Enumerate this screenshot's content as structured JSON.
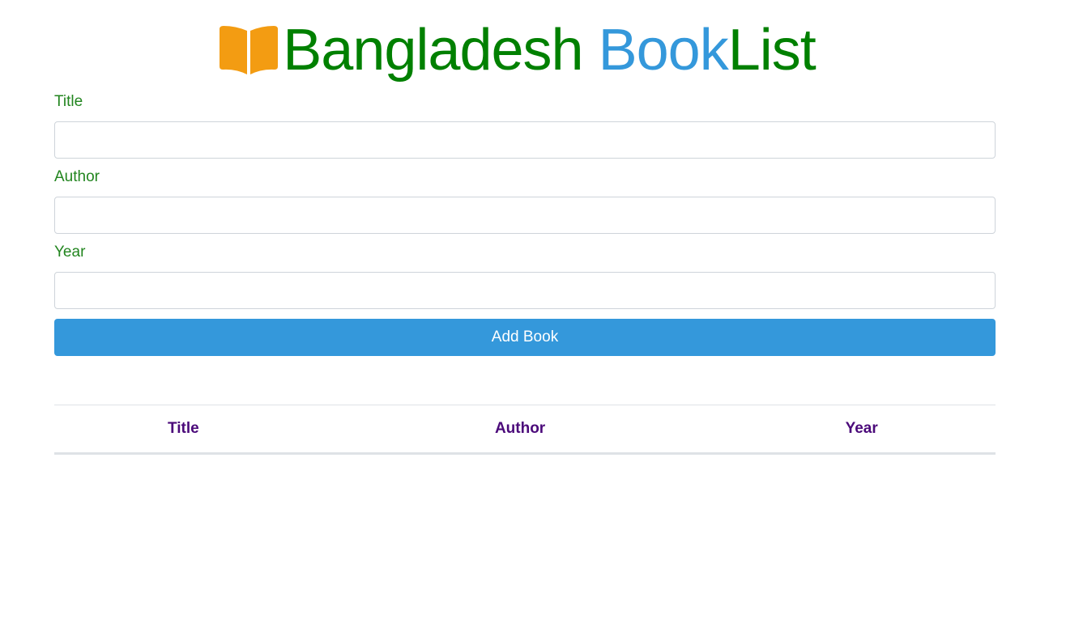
{
  "header": {
    "icon": "open-book-icon",
    "icon_color": "#f39c12",
    "title_part1": "Bangladesh",
    "title_part2": "Book",
    "title_part3": "List",
    "green": "#008000",
    "blue": "#3498db"
  },
  "form": {
    "title_label": "Title",
    "title_value": "",
    "author_label": "Author",
    "author_value": "",
    "year_label": "Year",
    "year_value": "",
    "submit_label": "Add Book",
    "submit_color": "#3498db"
  },
  "table": {
    "columns": [
      "Title",
      "Author",
      "Year"
    ],
    "header_color": "#4b0a7a",
    "rows": []
  }
}
